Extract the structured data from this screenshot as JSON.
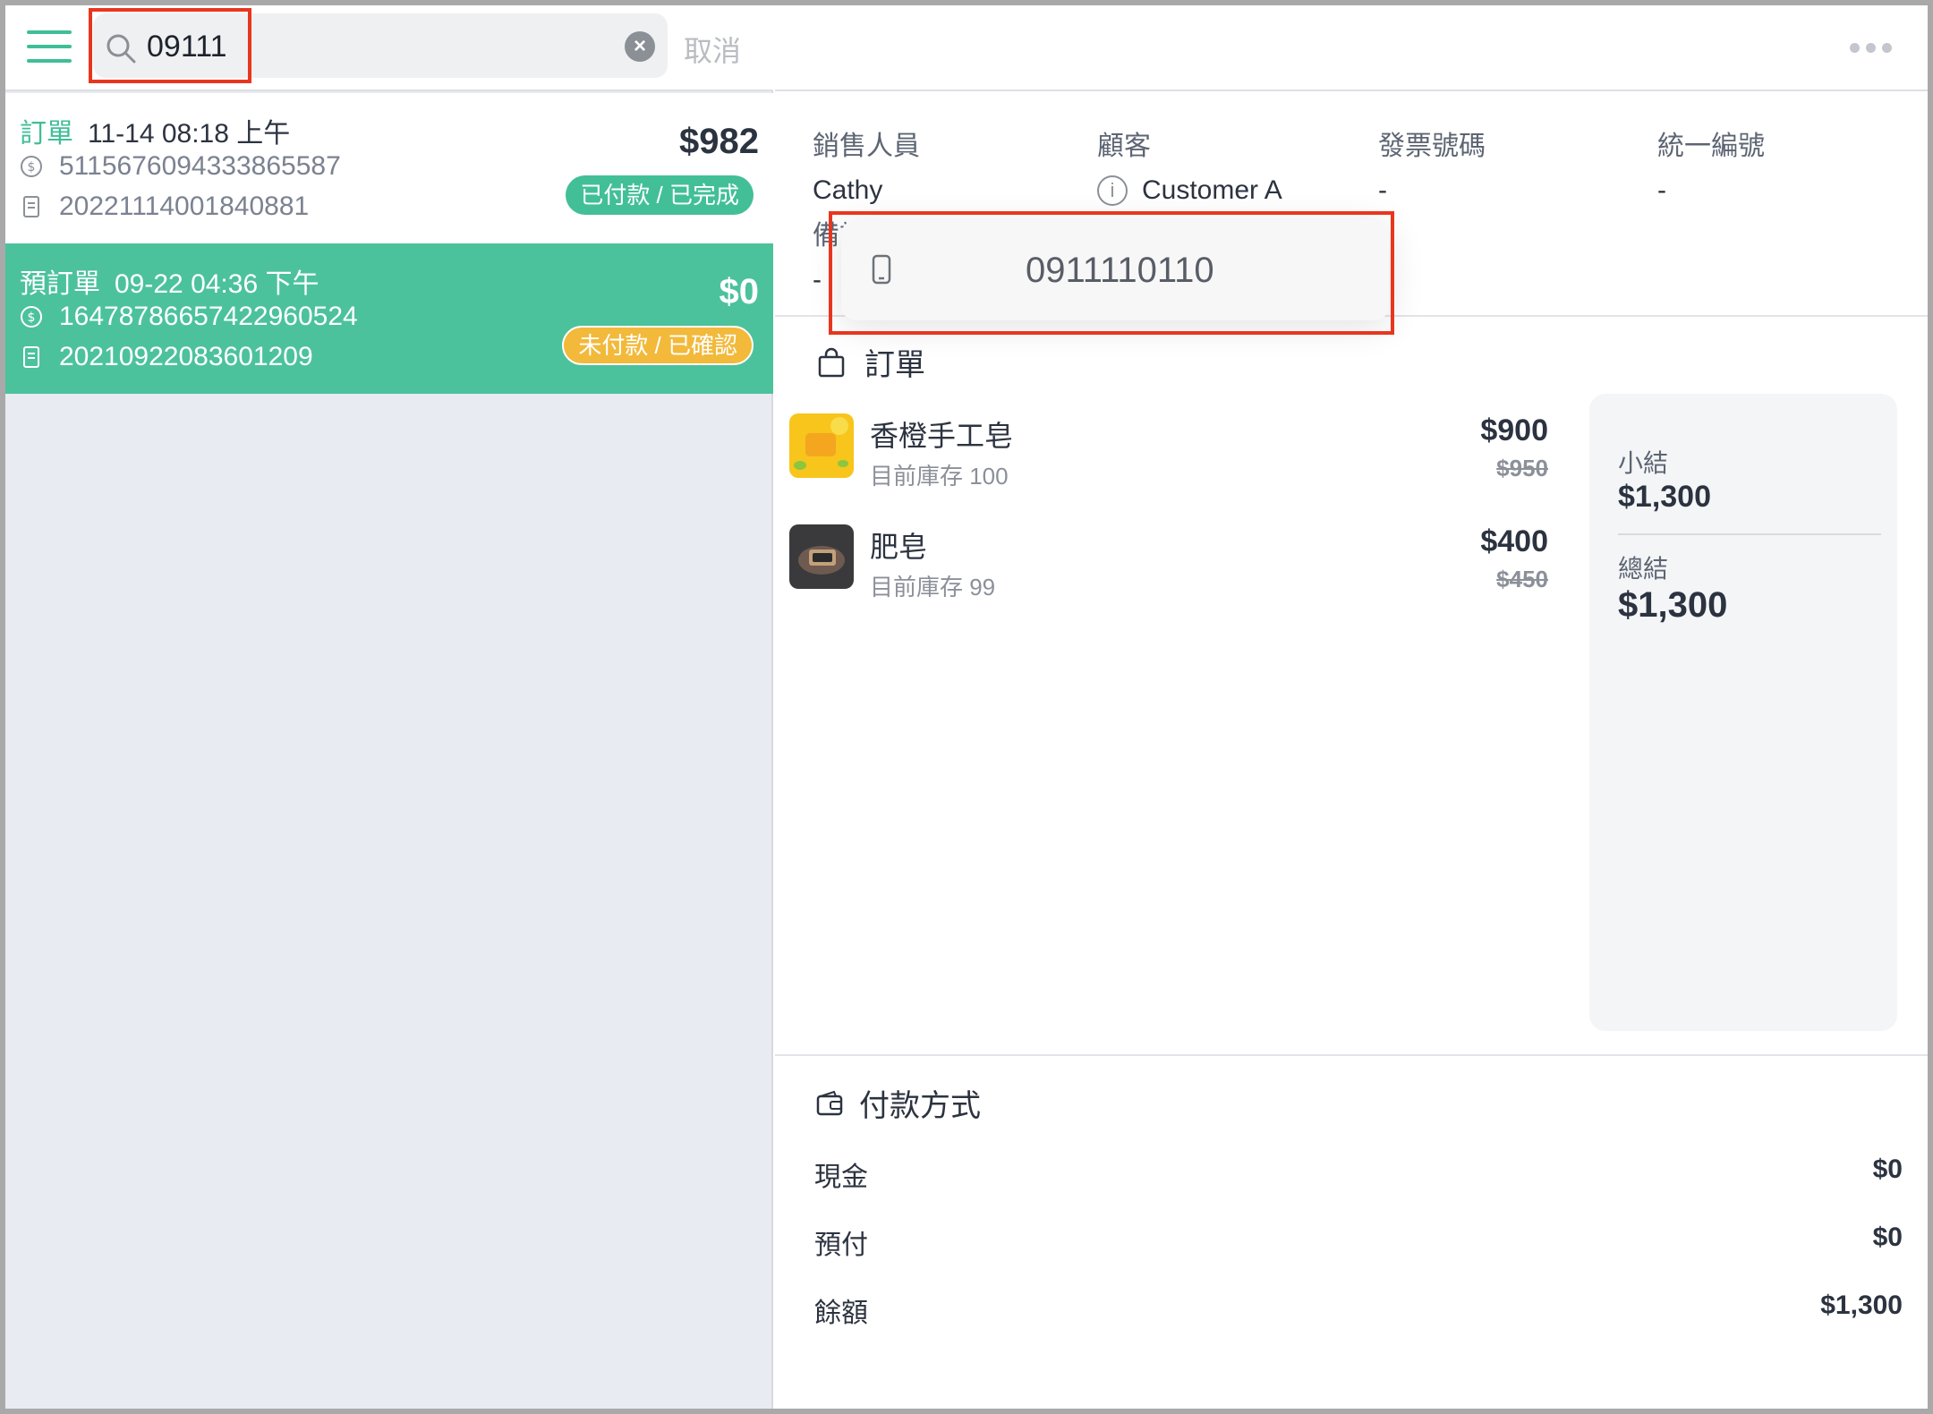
{
  "search": {
    "query": "09111",
    "cancel_label": "取消"
  },
  "orders": [
    {
      "kind": "訂單",
      "datetime": "11-14 08:18 上午",
      "payment_id": "5115676094333865587",
      "order_no": "20221114001840881",
      "amount": "$982",
      "status": "已付款 / 已完成"
    },
    {
      "kind": "預訂單",
      "datetime": "09-22 04:36 下午",
      "payment_id": "16478786657422960524",
      "order_no": "20210922083601209",
      "amount": "$0",
      "status": "未付款 / 已確認"
    }
  ],
  "detail": {
    "sales_label": "銷售人員",
    "sales_value": "Cathy",
    "customer_label": "顧客",
    "customer_value": "Customer A",
    "invoice_label": "發票號碼",
    "invoice_value": "-",
    "tax_label": "統一編號",
    "tax_value": "-",
    "note_label": "備註",
    "note_value": "-"
  },
  "popup": {
    "phone": "0911110110"
  },
  "order_section": {
    "title": "訂單",
    "items": [
      {
        "name": "香橙手工皂",
        "stock": "目前庫存 100",
        "price": "$900",
        "original_price": "$950"
      },
      {
        "name": "肥皂",
        "stock": "目前庫存 99",
        "price": "$400",
        "original_price": "$450"
      }
    ]
  },
  "summary": {
    "subtotal_label": "小結",
    "subtotal": "$1,300",
    "total_label": "總結",
    "total": "$1,300"
  },
  "payment": {
    "title": "付款方式",
    "rows": [
      {
        "label": "現金",
        "value": "$0"
      },
      {
        "label": "預付",
        "value": "$0"
      },
      {
        "label": "餘額",
        "value": "$1,300"
      }
    ]
  },
  "colors": {
    "accent": "#4cc29c",
    "pending": "#f2b93b",
    "highlight": "#e8361e"
  }
}
